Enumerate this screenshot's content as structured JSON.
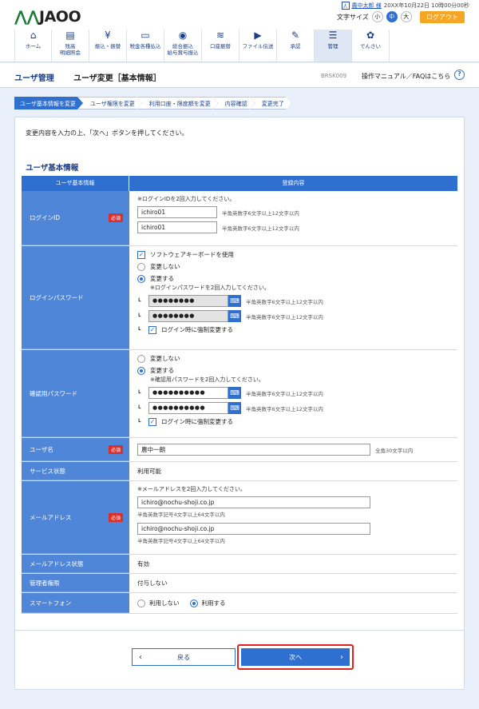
{
  "header": {
    "logo": "JAOO",
    "user_name": "農中太郎 様",
    "login_time": "20XX年10月22日 10時00分00秒",
    "font_size_label": "文字サイズ",
    "font_sizes": [
      "小",
      "中",
      "大"
    ],
    "logout_label": "ログアウト"
  },
  "nav": [
    {
      "label": "ホーム",
      "icon": "home-icon"
    },
    {
      "label": "残高\n明細照会",
      "icon": "document-icon"
    },
    {
      "label": "振込・振替",
      "icon": "yen-icon"
    },
    {
      "label": "税金各種払込",
      "icon": "payment-icon"
    },
    {
      "label": "総合振込\n給与賞与振込",
      "icon": "coins-icon"
    },
    {
      "label": "口座振替",
      "icon": "coins-stack-icon"
    },
    {
      "label": "ファイル伝送",
      "icon": "file-transfer-icon"
    },
    {
      "label": "承認",
      "icon": "approve-icon"
    },
    {
      "label": "管理",
      "icon": "admin-icon"
    },
    {
      "label": "でんさい",
      "icon": "densai-icon"
    }
  ],
  "titlebar": {
    "section": "ユーザ管理",
    "page_title": "ユーザ変更［基本情報］",
    "screen_id": "BRSK009",
    "help_text": "操作マニュアル／FAQはこちら",
    "help_icon": "?"
  },
  "steps": [
    "ユーザ基本情報を変更",
    "ユーザ権限を変更",
    "利用口座・限度額を変更",
    "内容確認",
    "変更完了"
  ],
  "instruction": "変更内容を入力の上、「次へ」ボタンを押してください。",
  "section_title": "ユーザ基本情報",
  "table": {
    "head_left": "ユーザ基本情報",
    "head_right": "登録内容",
    "required": "必須",
    "login_id": {
      "label": "ログインID",
      "note": "※ログインIDを2回入力してください。",
      "value1": "ichiro01",
      "value2": "ichiro01",
      "hint": "半角英数字6文字以上12文字以内"
    },
    "login_pw": {
      "label": "ログインパスワード",
      "software_kb": "ソフトウェアキーボードを使用",
      "no_change": "変更しない",
      "change": "変更する",
      "note": "※ログインパスワードを2回入力してください。",
      "masked": "●●●●●●●●",
      "hint": "半角英数字6文字以上12文字以内",
      "force": "ログイン時に強制変更する"
    },
    "confirm_pw": {
      "label": "確認用パスワード",
      "no_change": "変更しない",
      "change": "変更する",
      "note": "※確認用パスワードを2回入力してください。",
      "masked": "●●●●●●●●●●",
      "hint": "半角英数字6文字以上12文字以内",
      "force": "ログイン時に強制変更する"
    },
    "user_name": {
      "label": "ユーザ名",
      "value": "農中一朗",
      "hint": "全角30文字以内"
    },
    "service_status": {
      "label": "サービス状態",
      "value": "利用可能"
    },
    "email": {
      "label": "メールアドレス",
      "note": "※メールアドレスを2回入力してください。",
      "value1": "ichiro@nochu-shoji.co.jp",
      "value2": "ichiro@nochu-shoji.co.jp",
      "hint": "半角英数字記号4文字以上64文字以内"
    },
    "email_status": {
      "label": "メールアドレス状態",
      "value": "有効"
    },
    "admin_rights": {
      "label": "管理者権限",
      "value": "付与しない"
    },
    "smartphone": {
      "label": "スマートフォン",
      "opt_no": "利用しない",
      "opt_yes": "利用する"
    }
  },
  "buttons": {
    "back": "戻る",
    "next": "次へ"
  }
}
